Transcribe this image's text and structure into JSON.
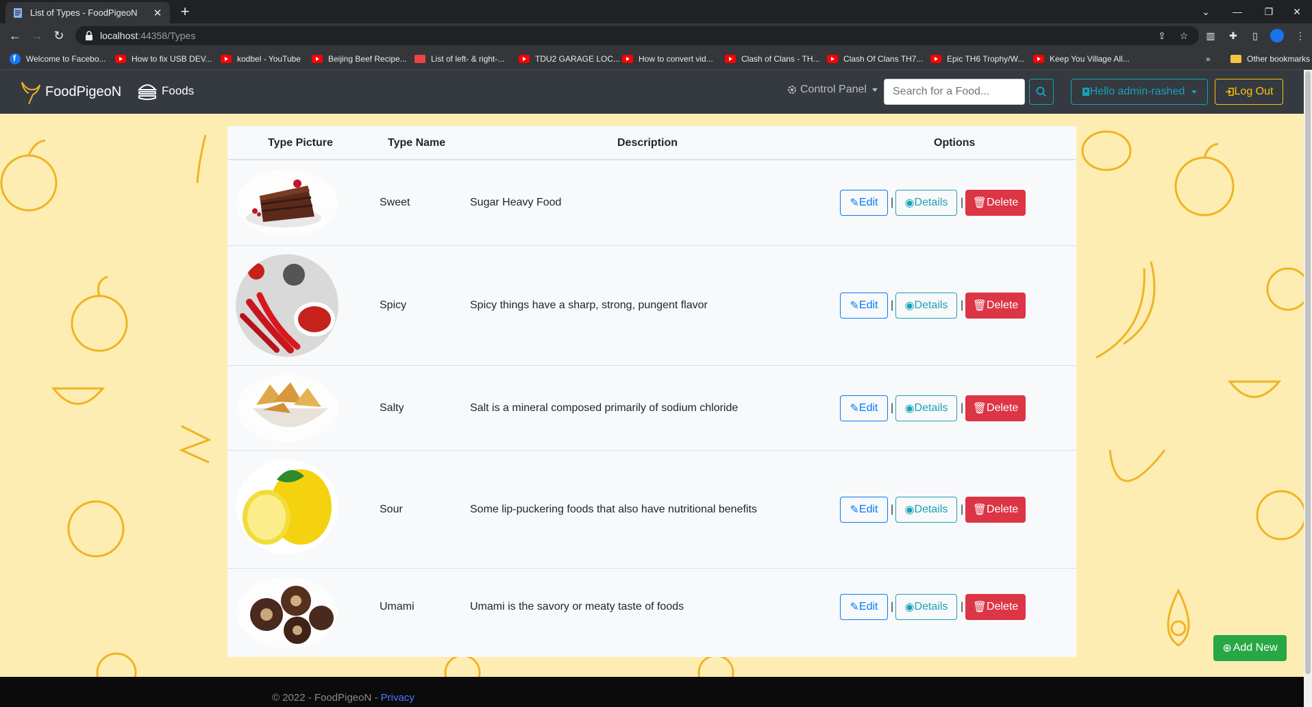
{
  "browser": {
    "tab_title": "List of Types - FoodPigeoN",
    "tab_close": "✕",
    "new_tab": "+",
    "url_host": "localhost",
    "url_rest": ":44358/Types",
    "bookmarks": [
      {
        "label": "Welcome to Facebo...",
        "icon": "facebook-icon"
      },
      {
        "label": "How to fix USB DEV...",
        "icon": "youtube-icon"
      },
      {
        "label": "kodbel - YouTube",
        "icon": "youtube-icon"
      },
      {
        "label": "Beijing Beef Recipe...",
        "icon": "youtube-icon"
      },
      {
        "label": "List of left- & right-...",
        "icon": "generic-icon"
      },
      {
        "label": "TDU2 GARAGE LOC...",
        "icon": "youtube-icon"
      },
      {
        "label": "How to convert vid...",
        "icon": "youtube-icon"
      },
      {
        "label": "Clash of Clans - TH...",
        "icon": "youtube-icon"
      },
      {
        "label": "Clash Of Clans TH7...",
        "icon": "youtube-icon"
      },
      {
        "label": "Epic TH6 Trophy/W...",
        "icon": "youtube-icon"
      },
      {
        "label": "Keep You Village All...",
        "icon": "youtube-icon"
      }
    ],
    "bookmarks_more": "»",
    "other_bookmarks": "Other bookmarks"
  },
  "nav": {
    "brand": "FoodPigeoN",
    "foods": "Foods",
    "control_panel": "Control Panel",
    "search_placeholder": "Search for a Food...",
    "hello": "Hello admin-rashed",
    "logout": "Log Out"
  },
  "table": {
    "headers": [
      "Type Picture",
      "Type Name",
      "Description",
      "Options"
    ],
    "rows": [
      {
        "name": "Sweet",
        "description": "Sugar Heavy Food"
      },
      {
        "name": "Spicy",
        "description": "Spicy things have a sharp, strong, pungent flavor"
      },
      {
        "name": "Salty",
        "description": "Salt is a mineral composed primarily of sodium chloride"
      },
      {
        "name": "Sour",
        "description": "Some lip-puckering foods that also have nutritional benefits"
      },
      {
        "name": "Umami",
        "description": "Umami is the savory or meaty taste of foods"
      }
    ],
    "edit_label": "Edit",
    "details_label": "Details",
    "delete_label": "Delete",
    "separator": "|"
  },
  "add_new": "Add New",
  "footer": {
    "copyright": "© 2022 - FoodPigeoN - ",
    "privacy": "Privacy"
  },
  "colors": {
    "page_bg": "#fdedb2",
    "navbar": "#343a40",
    "edit": "#007bff",
    "details": "#17a2b8",
    "delete": "#dc3545",
    "add_new": "#28a745",
    "logout": "#ffc107"
  }
}
